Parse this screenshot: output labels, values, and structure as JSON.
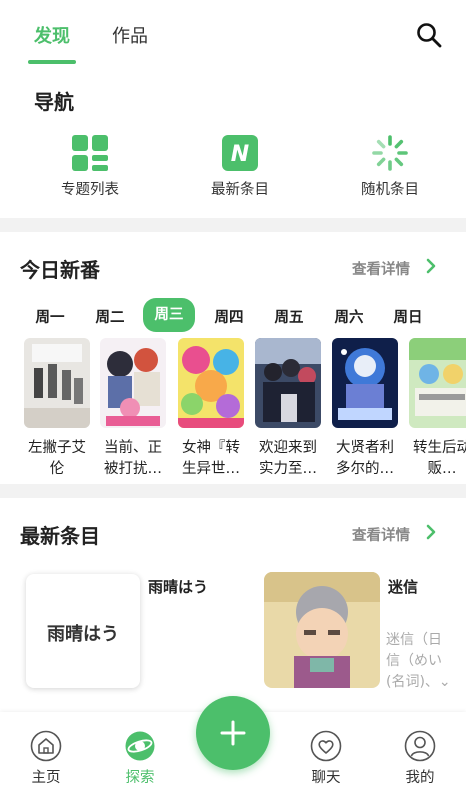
{
  "top_tabs": {
    "active": "发现",
    "inactive": "作品"
  },
  "nav": {
    "title": "导航",
    "items": [
      {
        "label": "专题列表",
        "icon": "grid-list-icon"
      },
      {
        "label": "最新条目",
        "icon": "new-badge-icon"
      },
      {
        "label": "随机条目",
        "icon": "spinner-icon"
      }
    ]
  },
  "today": {
    "title": "今日新番",
    "more": "查看详情",
    "days": [
      "周一",
      "周二",
      "周三",
      "周四",
      "周五",
      "周六",
      "周日"
    ],
    "active_day": "周三",
    "cards": [
      {
        "title": "左撇子艾伦"
      },
      {
        "title": "当前、正被打扰…"
      },
      {
        "title": "女神『转生异世…"
      },
      {
        "title": "欢迎来到实力至…"
      },
      {
        "title": "大贤者利多尔的…"
      },
      {
        "title": "转生后动贩…"
      }
    ]
  },
  "latest": {
    "title": "最新条目",
    "more": "查看详情",
    "entries": [
      {
        "card_text": "雨晴はう",
        "name": "雨晴はう"
      },
      {
        "name": "迷信",
        "desc_line1": "迷信（日",
        "desc_line2": "信（めい",
        "desc_line3": "(名词)、⌄"
      }
    ]
  },
  "bottom_nav": {
    "items": [
      {
        "label": "主页",
        "icon": "home-icon"
      },
      {
        "label": "探索",
        "icon": "planet-icon"
      },
      {
        "label": "聊天",
        "icon": "heart-chat-icon"
      },
      {
        "label": "我的",
        "icon": "user-icon"
      }
    ],
    "fab_icon": "plus-icon"
  },
  "colors": {
    "accent": "#4cbf6b",
    "muted": "#888888"
  }
}
